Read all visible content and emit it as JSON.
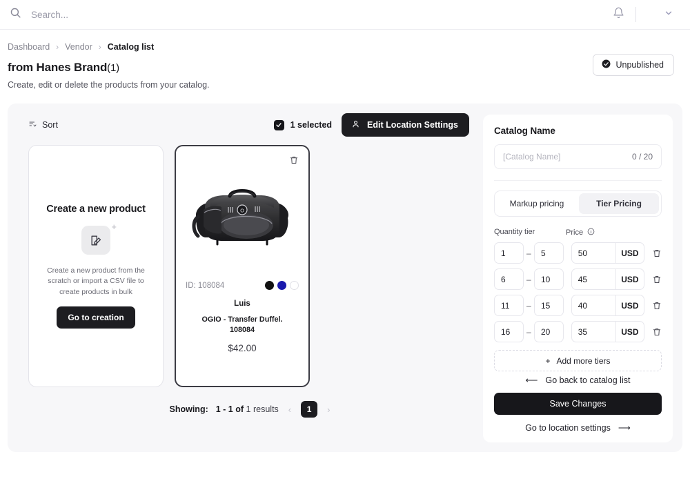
{
  "topbar": {
    "search_placeholder": "Search...",
    "search_value": "",
    "bell_icon": "bell-icon",
    "chevron_icon": "chevron-down-icon"
  },
  "breadcrumb": {
    "items": [
      {
        "label": "Dashboard",
        "active": false
      },
      {
        "label": "Vendor",
        "active": false
      },
      {
        "label": "Catalog list",
        "active": true
      }
    ],
    "separator": "›"
  },
  "page": {
    "title": "from Hanes Brand",
    "count": "(1)",
    "subtitle": "Create, edit or delete the products from your catalog.",
    "status_badge": "Unpublished"
  },
  "toolbar": {
    "sort_label": "Sort",
    "sort_icon": "sort-icon",
    "selected_label": "1 selected",
    "edit_location_label": "Edit Location Settings",
    "person_icon": "person-icon"
  },
  "create_card": {
    "title": "Create a new product",
    "description": "Create a new product from the scratch or import a CSV file to create products in bulk",
    "button_label": "Go to creation",
    "icon": "edit-document-icon",
    "plus": "+"
  },
  "product": {
    "id_label": "ID:",
    "id_value": "108084",
    "brand": "Luis",
    "name": "OGIO - Transfer Duffel.",
    "sku": "108084",
    "price": "$42.00",
    "delete_icon": "trash-icon",
    "image_alt": "black-duffel-bag",
    "swatches": [
      "#121212",
      "#1a1aad",
      "#ffffff"
    ]
  },
  "pagination": {
    "showing_label": "Showing:",
    "range": "1 - 1",
    "of": "of",
    "results": "1 results",
    "prev_icon": "chevron-left-icon",
    "next_icon": "chevron-right-icon",
    "current_page": "1"
  },
  "panel": {
    "title": "Catalog Name",
    "name_placeholder": "[Catalog Name]",
    "name_value": "",
    "char_counter": "0 / 20",
    "tabs": [
      {
        "label": "Markup pricing",
        "active": false
      },
      {
        "label": "Tier Pricing",
        "active": true
      }
    ],
    "quantity_header": "Quantity tier",
    "price_header": "Price",
    "info_icon": "info-icon",
    "dash": "–",
    "tiers": [
      {
        "min": "1",
        "max": "5",
        "price": "50",
        "currency": "USD"
      },
      {
        "min": "6",
        "max": "10",
        "price": "45",
        "currency": "USD"
      },
      {
        "min": "11",
        "max": "15",
        "price": "40",
        "currency": "USD"
      },
      {
        "min": "16",
        "max": "20",
        "price": "35",
        "currency": "USD"
      }
    ],
    "add_tiers_label": "Add more tiers",
    "add_tiers_plus": "+",
    "back_label": "Go back to catalog list",
    "back_arrow": "⟵",
    "save_label": "Save Changes",
    "goto_label": "Go to location settings",
    "goto_arrow": "⟶"
  },
  "colors": {
    "accent_dark": "#1d1d21",
    "page_bg": "#ffffff",
    "shell_bg": "#f7f7f9",
    "swatch_blue": "#1a1aad"
  }
}
